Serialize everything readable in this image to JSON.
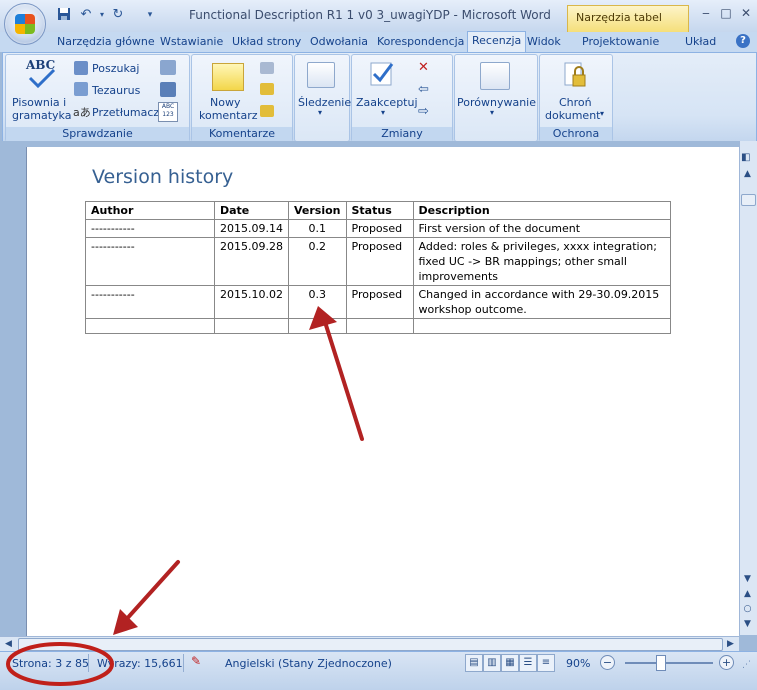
{
  "window": {
    "title": "Functional Description R1 1 v0 3_uwagiYDP - Microsoft Word",
    "context_tab": "Narzędzia tabel",
    "controls": [
      "minimize",
      "maximize",
      "close"
    ]
  },
  "quick_access": {
    "save_icon": "save-icon",
    "undo_icon": "undo-icon",
    "redo_icon": "redo-icon"
  },
  "tabs": [
    {
      "label": "Narzędzia główne",
      "active": false
    },
    {
      "label": "Wstawianie",
      "active": false
    },
    {
      "label": "Układ strony",
      "active": false
    },
    {
      "label": "Odwołania",
      "active": false
    },
    {
      "label": "Korespondencja",
      "active": false
    },
    {
      "label": "Recenzja",
      "active": true
    },
    {
      "label": "Widok",
      "active": false
    },
    {
      "label": "Projektowanie",
      "active": false
    },
    {
      "label": "Układ",
      "active": false
    }
  ],
  "ribbon": {
    "sprawdzanie": {
      "label": "Sprawdzanie",
      "spelling_line1": "Pisownia i",
      "spelling_line2": "gramatyka",
      "spelling_icon_text": "ABC",
      "research": "Poszukaj",
      "thesaurus": "Tezaurus",
      "translate": "Przetłumacz",
      "wordcount_icon_text": "ABC 123"
    },
    "komentarze": {
      "label": "Komentarze",
      "new_line1": "Nowy",
      "new_line2": "komentarz"
    },
    "sledzenie": {
      "label": "Śledzenie"
    },
    "zmiany": {
      "label": "Zmiany",
      "accept": "Zaakceptuj"
    },
    "porownywanie": {
      "label": "Porównywanie"
    },
    "ochrona": {
      "label": "Ochrona",
      "protect_line1": "Chroń",
      "protect_line2": "dokument"
    }
  },
  "document": {
    "heading": "Version history",
    "table": {
      "headers": [
        "Author",
        "Date",
        "Version",
        "Status",
        "Description"
      ],
      "rows": [
        [
          "-----------",
          "2015.09.14",
          "0.1",
          "Proposed",
          "First version of the document"
        ],
        [
          "-----------",
          "2015.09.28",
          "0.2",
          "Proposed",
          "Added: roles & privileges, xxxx integration; fixed UC -> BR mappings; other small improvements"
        ],
        [
          "-----------",
          "2015.10.02",
          "0.3",
          "Proposed",
          "Changed in accordance with 29-30.09.2015 workshop outcome."
        ]
      ]
    }
  },
  "statusbar": {
    "page": "Strona: 3 z 85",
    "words": "Wyrazy: 15,661",
    "language": "Angielski (Stany Zjednoczone)",
    "zoom": "90%"
  },
  "annotations": {
    "arrow_color": "#b22222",
    "circle_color": "#c0201a"
  }
}
